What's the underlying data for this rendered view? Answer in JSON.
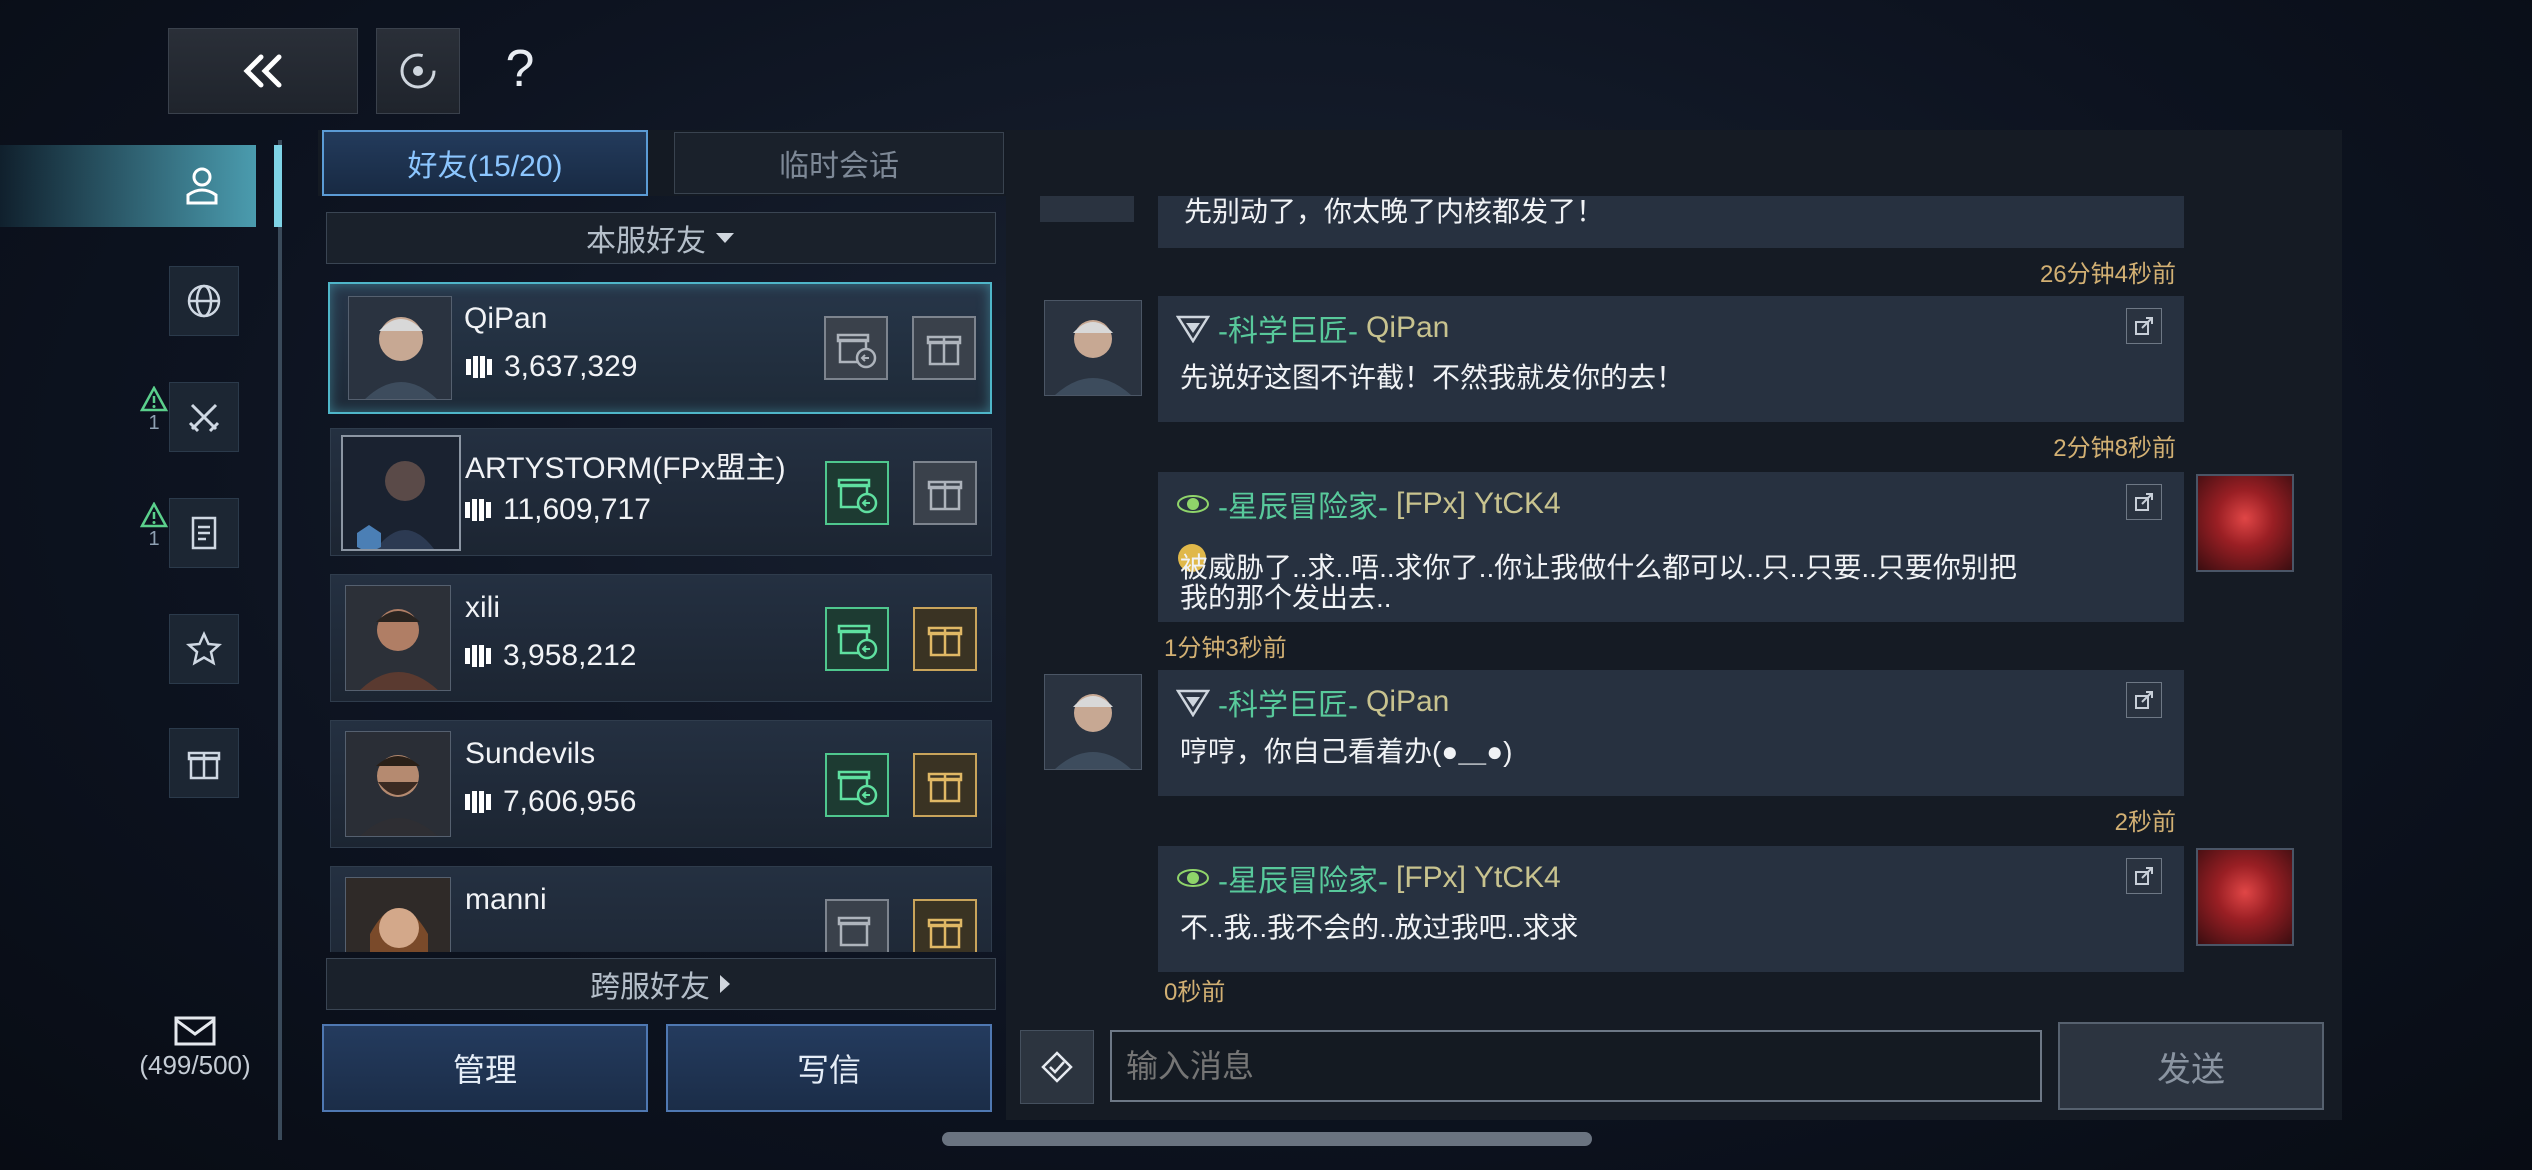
{
  "top": {
    "back_icon": "double-chevron-left-icon",
    "target_icon": "target-icon",
    "help_label": "?"
  },
  "sidebar": {
    "items": [
      {
        "icon": "person-icon",
        "active": true
      },
      {
        "icon": "globe-icon"
      },
      {
        "icon": "crossed-swords-icon",
        "badge": "1"
      },
      {
        "icon": "document-icon",
        "badge": "1"
      },
      {
        "icon": "star-icon"
      },
      {
        "icon": "gift-icon"
      }
    ],
    "mail": {
      "icon": "mail-icon",
      "count": "(499/500)"
    }
  },
  "tabs": [
    {
      "label": "好友(15/20)",
      "active": true
    },
    {
      "label": "临时会话",
      "active": false
    }
  ],
  "friends": {
    "section_label": "本服好友",
    "cross_server_label": "跨服好友",
    "list": [
      {
        "name": "QiPan",
        "power": "3,637,329",
        "selected": true,
        "gift1": "grey",
        "gift2": "grey"
      },
      {
        "name": "ARTYSTORM(FPx盟主)",
        "power": "11,609,717",
        "gift1": "green",
        "gift2": "grey"
      },
      {
        "name": "xili",
        "power": "3,958,212",
        "gift1": "green",
        "gift2": "gold"
      },
      {
        "name": "Sundevils",
        "power": "7,606,956",
        "gift1": "green",
        "gift2": "gold"
      },
      {
        "name": "manni",
        "power": "",
        "gift1": "grey",
        "gift2": "gold"
      }
    ]
  },
  "actions": {
    "manage": "管理",
    "write": "写信"
  },
  "chat": {
    "partial_text": "先别动了，你太晚了内核都发了！",
    "ts0": "26分钟4秒前",
    "messages": [
      {
        "title": "-科学巨匠-",
        "name": "QiPan",
        "text": "先说好这图不许截！不然我就发你的去！",
        "time": "2分钟8秒前",
        "side": "left"
      },
      {
        "title": "-星辰冒险家-",
        "tag": "[FPx]",
        "name": "YtCK4",
        "text1": "被威胁了..求..唔..求你了..你让我做什么都可以..只..只要..只要你别把",
        "text2": "我的那个发出去..",
        "time": "1分钟3秒前",
        "side": "right"
      },
      {
        "title": "-科学巨匠-",
        "name": "QiPan",
        "text": "哼哼，你自己看着办(●＿●)",
        "time": "2秒前",
        "side": "left"
      },
      {
        "title": "-星辰冒险家-",
        "tag": "[FPx]",
        "name": "YtCK4",
        "text": "不..我..我不会的..放过我吧..求求",
        "time": "0秒前",
        "side": "right"
      }
    ],
    "input_placeholder": "输入消息",
    "send_label": "发送"
  }
}
